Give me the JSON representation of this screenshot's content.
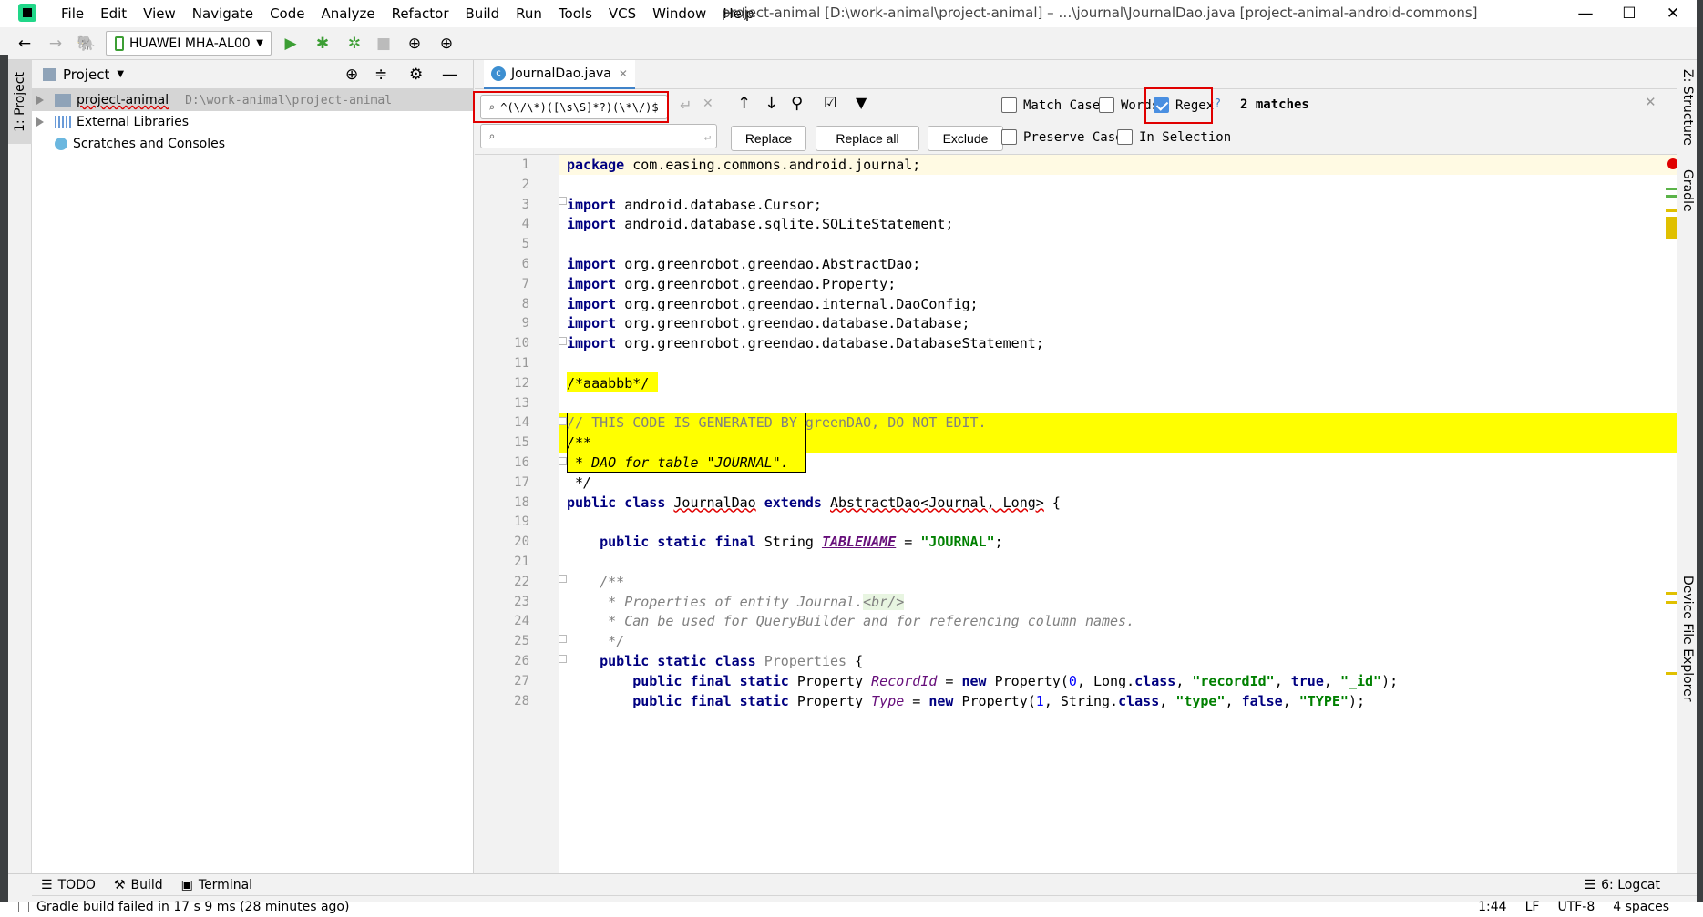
{
  "menu": [
    "File",
    "Edit",
    "View",
    "Navigate",
    "Code",
    "Analyze",
    "Refactor",
    "Build",
    "Run",
    "Tools",
    "VCS",
    "Window",
    "Help"
  ],
  "window_title": "project-animal [D:\\work-animal\\project-animal] – …\\journal\\JournalDao.java [project-animal-android-commons]",
  "device": "HUAWEI MHA-AL00",
  "project_panel": {
    "title": "Project",
    "tab_label": "1: Project",
    "tree": [
      {
        "label": "project-animal",
        "path": "D:\\work-animal\\project-animal"
      },
      {
        "label": "External Libraries"
      },
      {
        "label": "Scratches and Consoles"
      }
    ]
  },
  "editor_tab": "JournalDao.java",
  "find": {
    "search_value": "^(\\/\\*)([\\s\\S]*?)(\\*\\/)$",
    "replace_value": "",
    "match_case": "Match Case",
    "words": "Words",
    "regex": "Regex",
    "help": "?",
    "matches": "2 matches",
    "preserve_case": "Preserve Case",
    "in_selection": "In Selection",
    "replace_btn": "Replace",
    "replace_all_btn": "Replace all",
    "exclude_btn": "Exclude"
  },
  "code_lines": [
    {
      "n": "1"
    },
    {
      "n": "2"
    },
    {
      "n": "3"
    },
    {
      "n": "4"
    },
    {
      "n": "5"
    },
    {
      "n": "6"
    },
    {
      "n": "7"
    },
    {
      "n": "8"
    },
    {
      "n": "9"
    },
    {
      "n": "10"
    },
    {
      "n": "11"
    },
    {
      "n": "12"
    },
    {
      "n": "13"
    },
    {
      "n": "14"
    },
    {
      "n": "15"
    },
    {
      "n": "16"
    },
    {
      "n": "17"
    },
    {
      "n": "18"
    },
    {
      "n": "19"
    },
    {
      "n": "20"
    },
    {
      "n": "21"
    },
    {
      "n": "22"
    },
    {
      "n": "23"
    },
    {
      "n": "24"
    },
    {
      "n": "25"
    },
    {
      "n": "26"
    },
    {
      "n": "27"
    },
    {
      "n": "28"
    }
  ],
  "right_tools": {
    "structure": "Z: Structure",
    "gradle": "Gradle",
    "device_explorer": "Device File Explorer"
  },
  "bottom_tools": {
    "todo": "TODO",
    "build": "Build",
    "terminal": "Terminal",
    "logcat": "6: Logcat"
  },
  "status": {
    "message": "Gradle build failed in 17 s 9 ms (28 minutes ago)",
    "position": "1:44",
    "line_sep": "LF",
    "encoding": "UTF-8",
    "indent": "4 spaces"
  }
}
